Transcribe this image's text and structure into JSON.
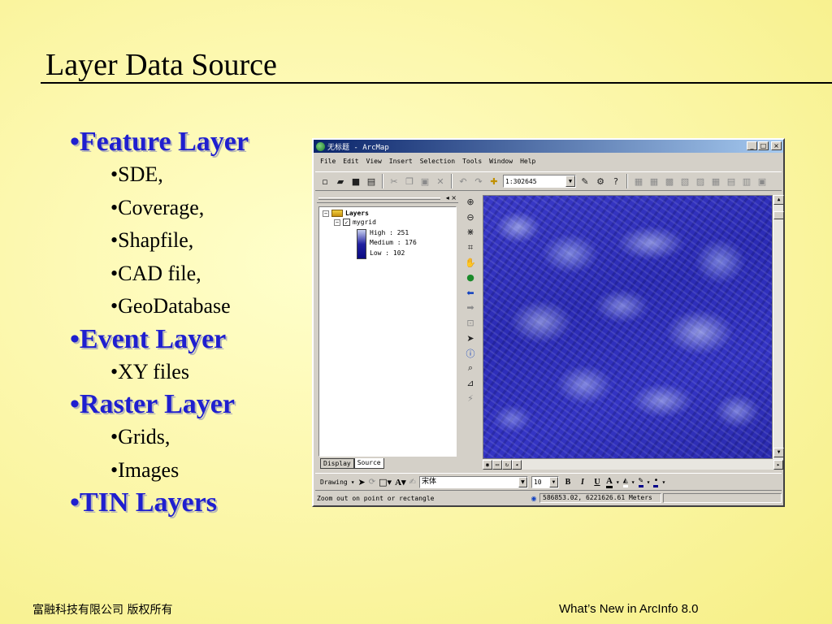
{
  "slide": {
    "title": "Layer Data Source",
    "bullets": [
      {
        "label": "Feature Layer",
        "subs": [
          "SDE,",
          "Coverage,",
          "Shapfile,",
          "CAD file,",
          "GeoDatabase"
        ]
      },
      {
        "label": "Event Layer",
        "subs": [
          "XY files"
        ]
      },
      {
        "label": "Raster Layer",
        "subs": [
          "Grids,",
          "Images"
        ]
      },
      {
        "label": "TIN Layers",
        "subs": []
      }
    ],
    "footer_left": "富融科技有限公司 版权所有",
    "footer_right": "What’s New in ArcInfo 8.0"
  },
  "arcmap": {
    "window_title": "无标题 - ArcMap",
    "window_buttons": {
      "minimize": "_",
      "maximize": "□",
      "close": "×"
    },
    "menu": [
      "File",
      "Edit",
      "View",
      "Insert",
      "Selection",
      "Tools",
      "Window",
      "Help"
    ],
    "scale": "1:302645",
    "toc": {
      "root": "Layers",
      "layer": "mygrid",
      "legend": [
        "High : 251",
        "Medium : 176",
        "Low : 102"
      ],
      "tabs": [
        "Display",
        "Source"
      ]
    },
    "drawing_label": "Drawing",
    "font_name": "宋体",
    "font_size": "10",
    "format_buttons": [
      "B",
      "I",
      "U"
    ],
    "status_message": "Zoom out on point or rectangle",
    "coordinates": "586853.02, 6221626.61 Meters"
  }
}
